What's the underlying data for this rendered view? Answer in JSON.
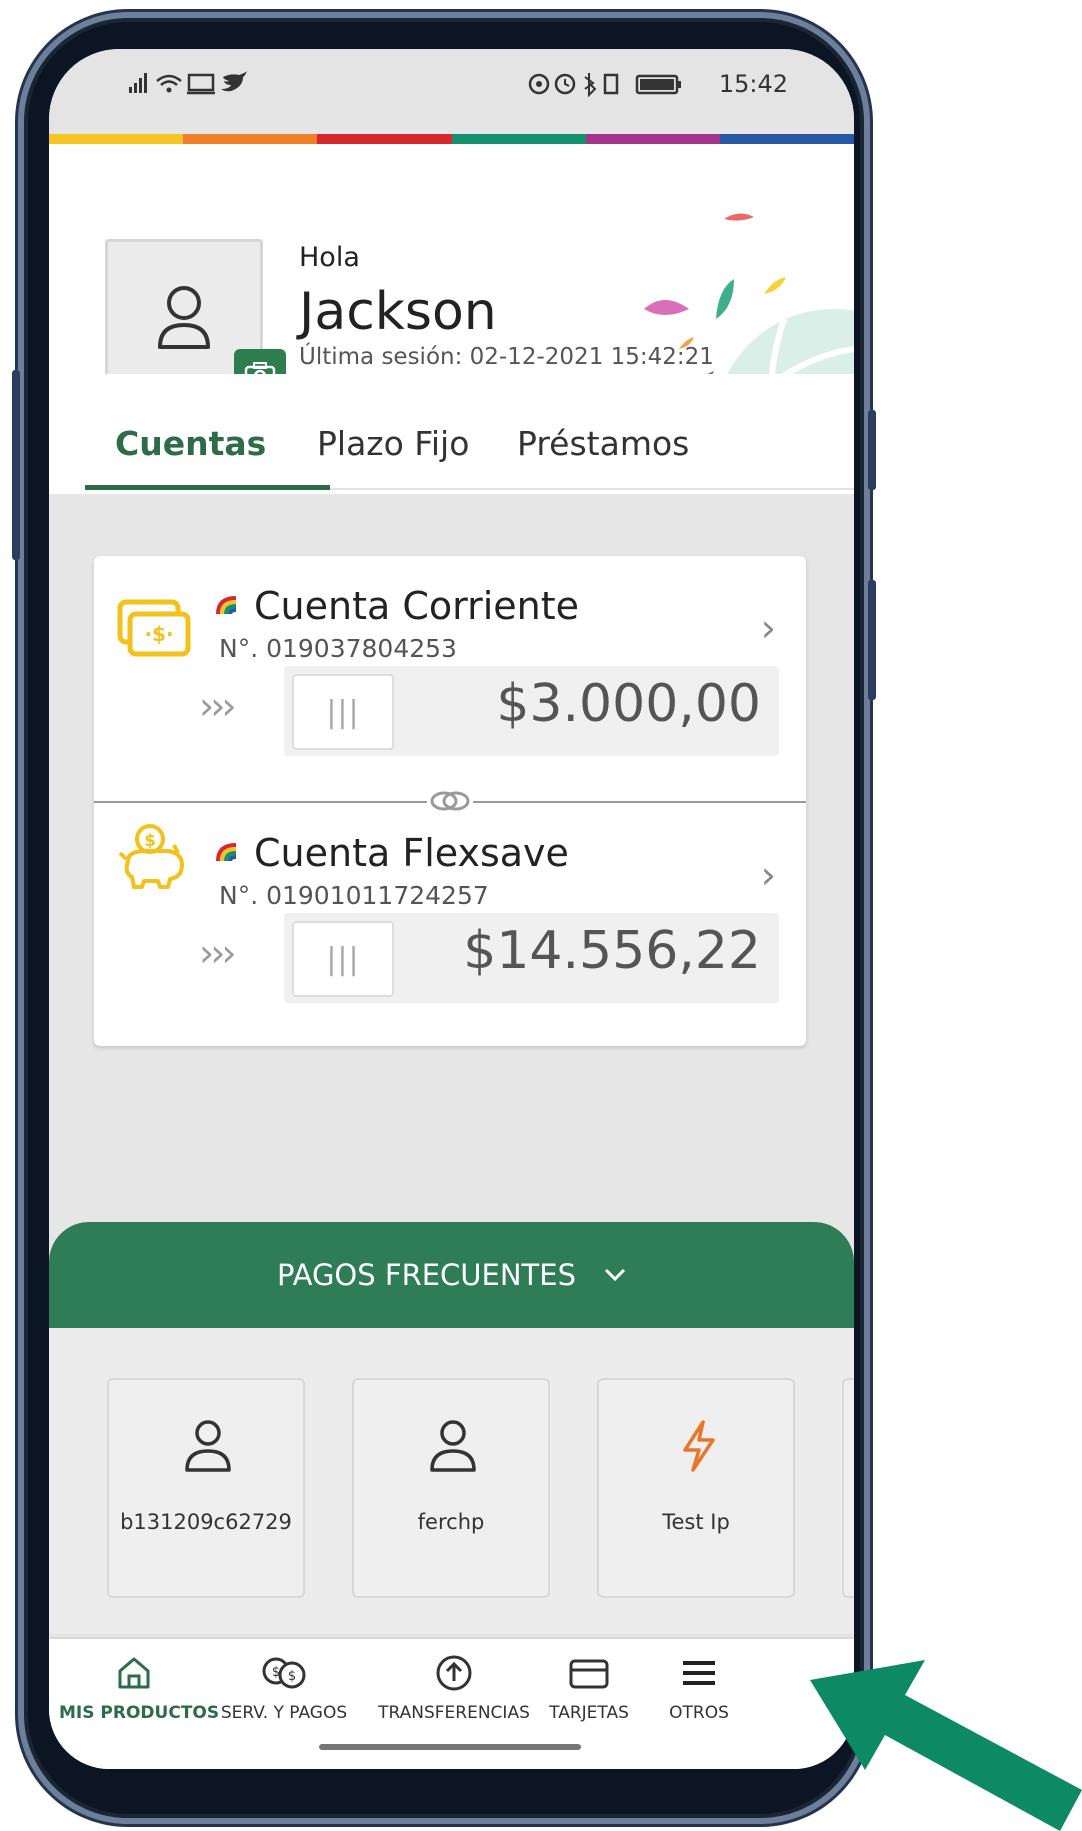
{
  "status_bar": {
    "left_icons": "signal wifi cast twitter",
    "time": "15:42"
  },
  "brand_stripe_colors": [
    "#f5c623",
    "#f07f2a",
    "#d7282f",
    "#15906f",
    "#a3348c",
    "#2658a6"
  ],
  "profile": {
    "greeting": "Hola",
    "name": "Jackson",
    "last_session": "Última sesión: 02-12-2021 15:42:21"
  },
  "tabs": [
    {
      "label": "Cuentas",
      "active": true
    },
    {
      "label": "Plazo Fijo",
      "active": false
    },
    {
      "label": "Préstamos",
      "active": false
    }
  ],
  "accounts": [
    {
      "name": "Cuenta Corriente",
      "number": "N°. 019037804253",
      "amount": "$3.000,00",
      "icon": "money-bill-icon",
      "slider_arrows": "›››",
      "slider_grip": "|||"
    },
    {
      "name": "Cuenta Flexsave",
      "number": "N°. 01901011724257",
      "amount": "$14.556,22",
      "icon": "piggy-bank-icon",
      "slider_arrows": "›››",
      "slider_grip": "|||"
    }
  ],
  "frequent_payments": {
    "title": "PAGOS FRECUENTES",
    "items": [
      {
        "label": "b131209c62729",
        "icon": "user-icon"
      },
      {
        "label": "ferchp",
        "icon": "user-icon"
      },
      {
        "label": "Test Ip",
        "icon": "lightning-icon"
      }
    ]
  },
  "bottom_nav": [
    {
      "label": "MIS PRODUCTOS",
      "icon": "home-icon",
      "active": true
    },
    {
      "label": "SERV. Y PAGOS",
      "icon": "coins-icon",
      "active": false
    },
    {
      "label": "TRANSFERENCIAS",
      "icon": "arrow-up-circle-icon",
      "active": false
    },
    {
      "label": "TARJETAS",
      "icon": "card-icon",
      "active": false
    },
    {
      "label": "OTROS",
      "icon": "menu-icon",
      "active": false
    }
  ],
  "colors": {
    "primary_green": "#2e7d57",
    "active_tab": "#2e6b47",
    "money_yellow": "#f2c21b",
    "lightning_orange": "#e8772a",
    "pointer_arrow": "#0d8a63"
  }
}
